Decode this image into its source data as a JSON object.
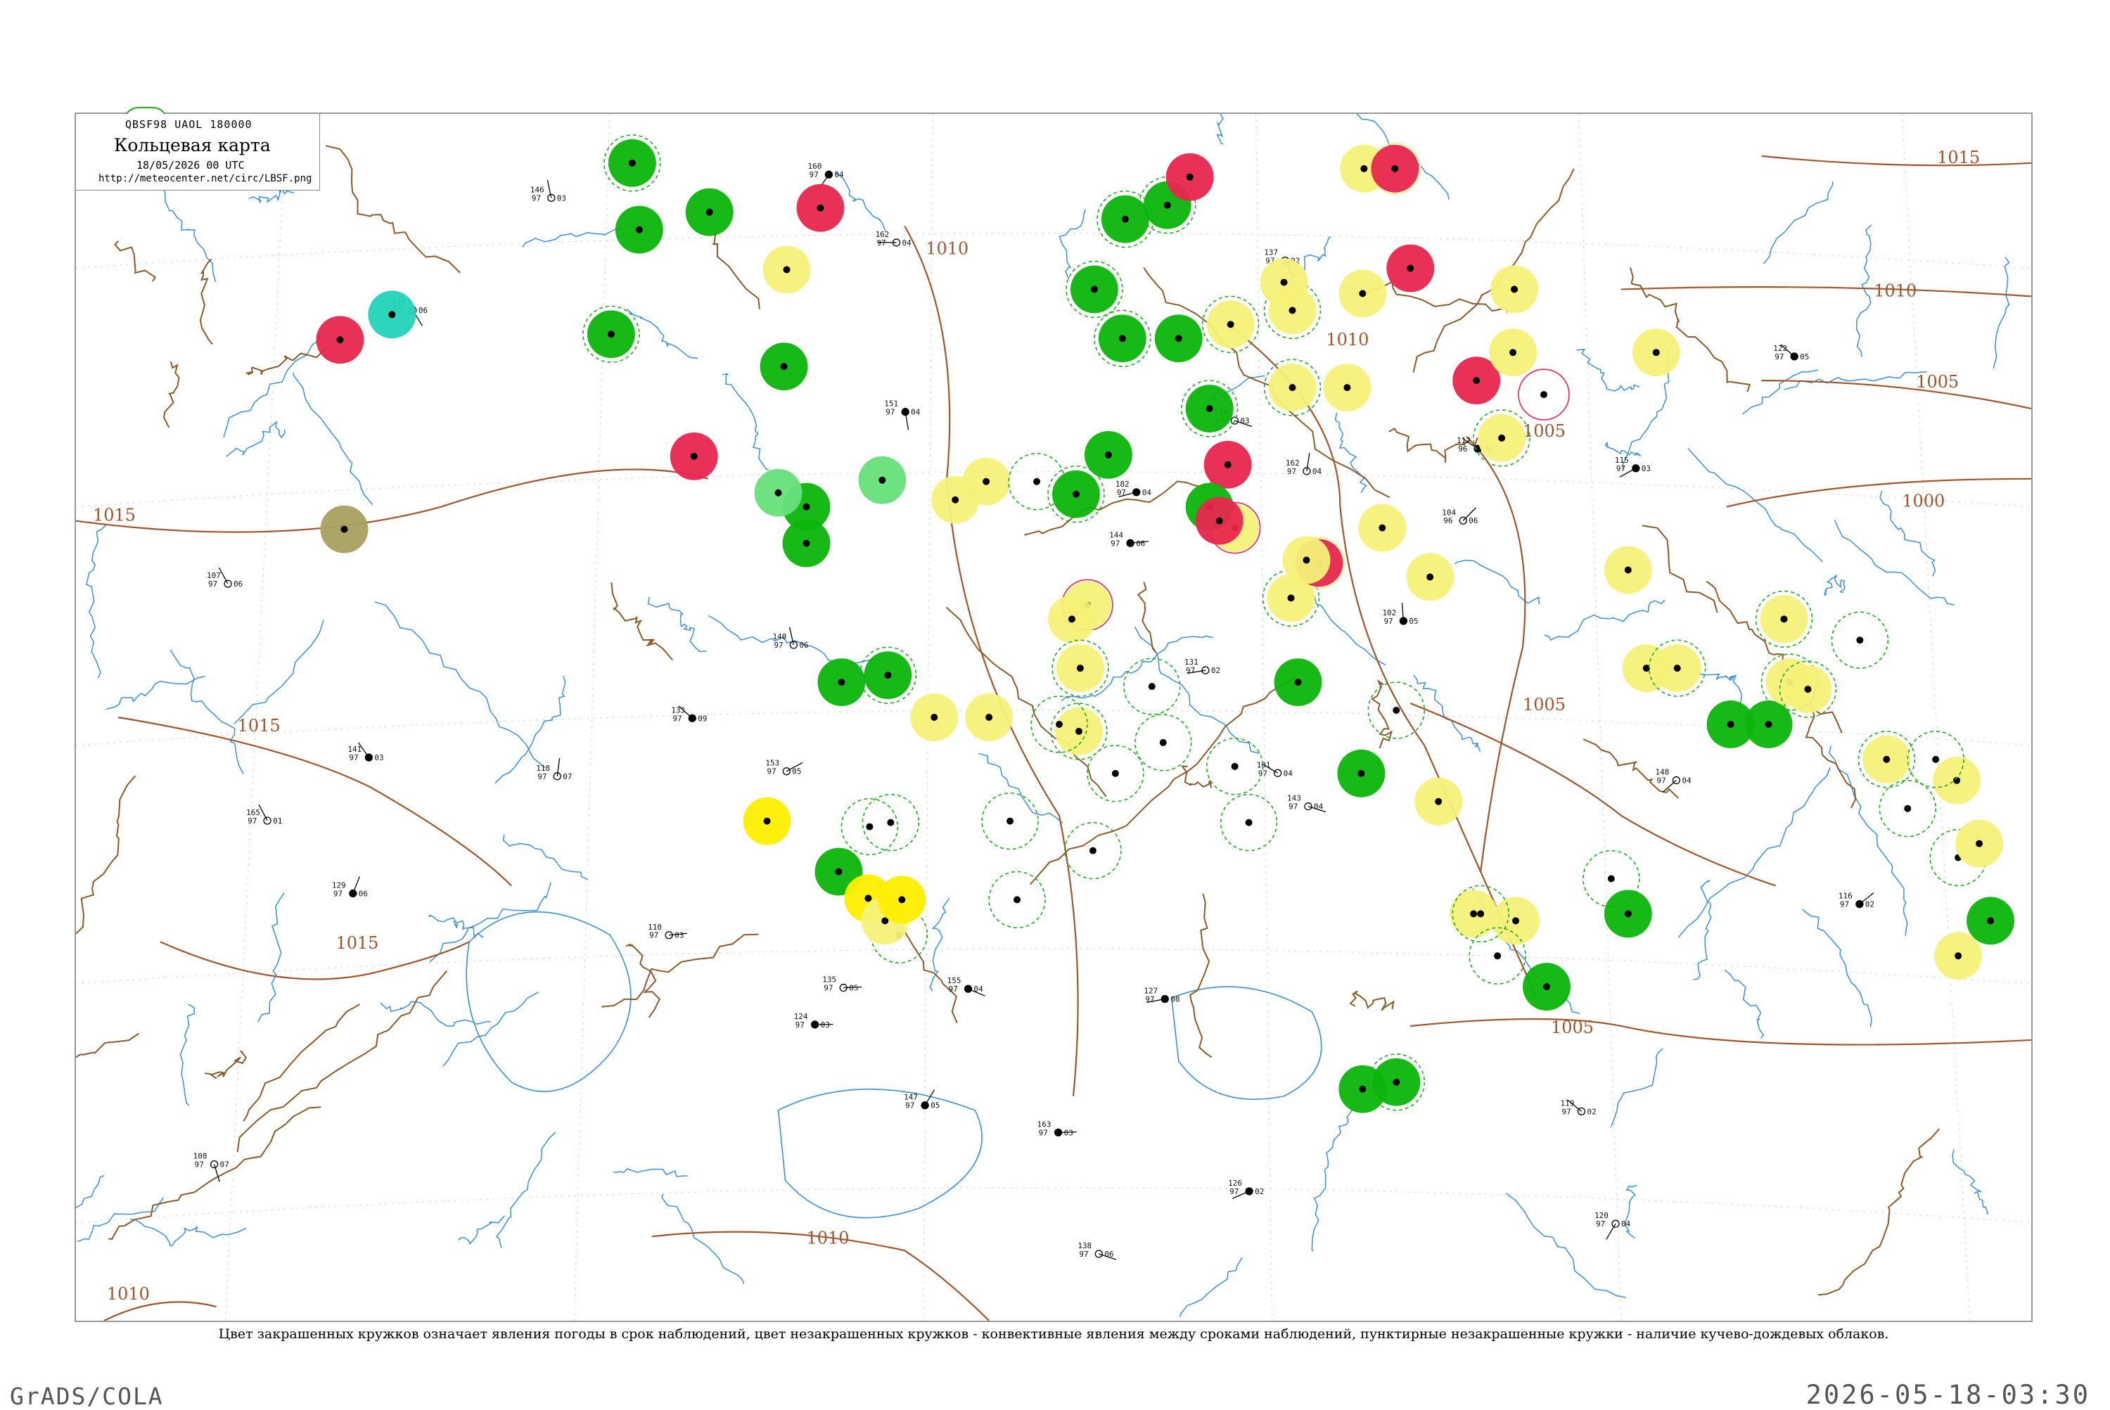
{
  "header": {
    "codes": "QBSF98  UAOL  180000",
    "title": "Кольцевая карта",
    "date": "18/05/2026 00 UTC",
    "url": "http://meteocenter.net/circ/LBSF.png"
  },
  "caption": "Цвет закрашенных кружков означает явления погоды в срок наблюдений, цвет незакрашенных кружков - конвективные явления между сроками наблюдений, пунктирные незакрашенные кружки - наличие кучево-дождевых облаков.",
  "footer": {
    "left": "GrADS/COLA",
    "right": "2026-05-18-03:30"
  },
  "colors": {
    "isobar": "#a0552c",
    "river": "#3a8fd8",
    "border": "#8b5a2b",
    "rain": "#0ab50a",
    "shower_ring": "#22aa22",
    "showers_light": "#f6f178",
    "thunder": "#e8264e",
    "hail": "#21d3b8",
    "light_green": "#66e07a",
    "fog": "#ffee00",
    "haze": "#a8a060"
  },
  "isobars": [
    {
      "value": "1015",
      "label": "1015"
    },
    {
      "value": "1015",
      "label": "1015"
    },
    {
      "value": "1015",
      "label": "1015"
    },
    {
      "value": "1010",
      "label": "1010"
    },
    {
      "value": "1010",
      "label": "1010"
    },
    {
      "value": "1010",
      "label": "1010"
    },
    {
      "value": "1010",
      "label": "1010"
    },
    {
      "value": "1005",
      "label": "1005"
    },
    {
      "value": "1005",
      "label": "1005"
    },
    {
      "value": "1005",
      "label": "1005"
    },
    {
      "value": "1000",
      "label": "1000"
    },
    {
      "value": "1005",
      "label": "1005"
    },
    {
      "value": "1010",
      "label": "1010"
    },
    {
      "value": "1015",
      "label": "1015"
    }
  ],
  "stations": [
    {
      "t": "104",
      "p": "96",
      "d": "06"
    },
    {
      "t": "120",
      "p": "97",
      "d": "04"
    },
    {
      "t": "141",
      "p": "97",
      "d": "03"
    },
    {
      "t": "165",
      "p": "97",
      "d": "01"
    },
    {
      "t": "182",
      "p": "97",
      "d": "04"
    },
    {
      "t": "107",
      "p": "97",
      "d": "06"
    },
    {
      "t": "131",
      "p": "97",
      "d": "02"
    },
    {
      "t": "160",
      "p": "97",
      "d": "04"
    },
    {
      "t": "144",
      "p": "97",
      "d": "06"
    },
    {
      "t": "112",
      "p": "96",
      "d": "06"
    },
    {
      "t": "174",
      "p": "97",
      "d": "03"
    },
    {
      "t": "151",
      "p": "97",
      "d": "04"
    },
    {
      "t": "126",
      "p": "97",
      "d": "02"
    },
    {
      "t": "143",
      "p": "97",
      "d": "04"
    },
    {
      "t": "122",
      "p": "97",
      "d": "05"
    },
    {
      "t": "162",
      "p": "97",
      "d": "04"
    },
    {
      "t": "140",
      "p": "97",
      "d": "06"
    },
    {
      "t": "118",
      "p": "97",
      "d": "07"
    },
    {
      "t": "153",
      "p": "97",
      "d": "05"
    },
    {
      "t": "101",
      "p": "97",
      "d": "04"
    },
    {
      "t": "133",
      "p": "97",
      "d": "09"
    },
    {
      "t": "162",
      "p": "97",
      "d": "04"
    },
    {
      "t": "147",
      "p": "97",
      "d": "05"
    },
    {
      "t": "119",
      "p": "97",
      "d": "02"
    },
    {
      "t": "138",
      "p": "97",
      "d": "06"
    },
    {
      "t": "115",
      "p": "97",
      "d": "03"
    },
    {
      "t": "127",
      "p": "97",
      "d": "08"
    },
    {
      "t": "146",
      "p": "97",
      "d": "03"
    },
    {
      "t": "149",
      "p": "97",
      "d": "06"
    },
    {
      "t": "137",
      "p": "97",
      "d": "02"
    },
    {
      "t": "102",
      "p": "97",
      "d": "05"
    },
    {
      "t": "124",
      "p": "97",
      "d": "03"
    },
    {
      "t": "155",
      "p": "97",
      "d": "04"
    },
    {
      "t": "108",
      "p": "97",
      "d": "07"
    },
    {
      "t": "163",
      "p": "97",
      "d": "03"
    },
    {
      "t": "135",
      "p": "97",
      "d": "05"
    },
    {
      "t": "129",
      "p": "97",
      "d": "06"
    },
    {
      "t": "116",
      "p": "97",
      "d": "02"
    },
    {
      "t": "148",
      "p": "97",
      "d": "04"
    },
    {
      "t": "110",
      "p": "97",
      "d": "03"
    }
  ]
}
